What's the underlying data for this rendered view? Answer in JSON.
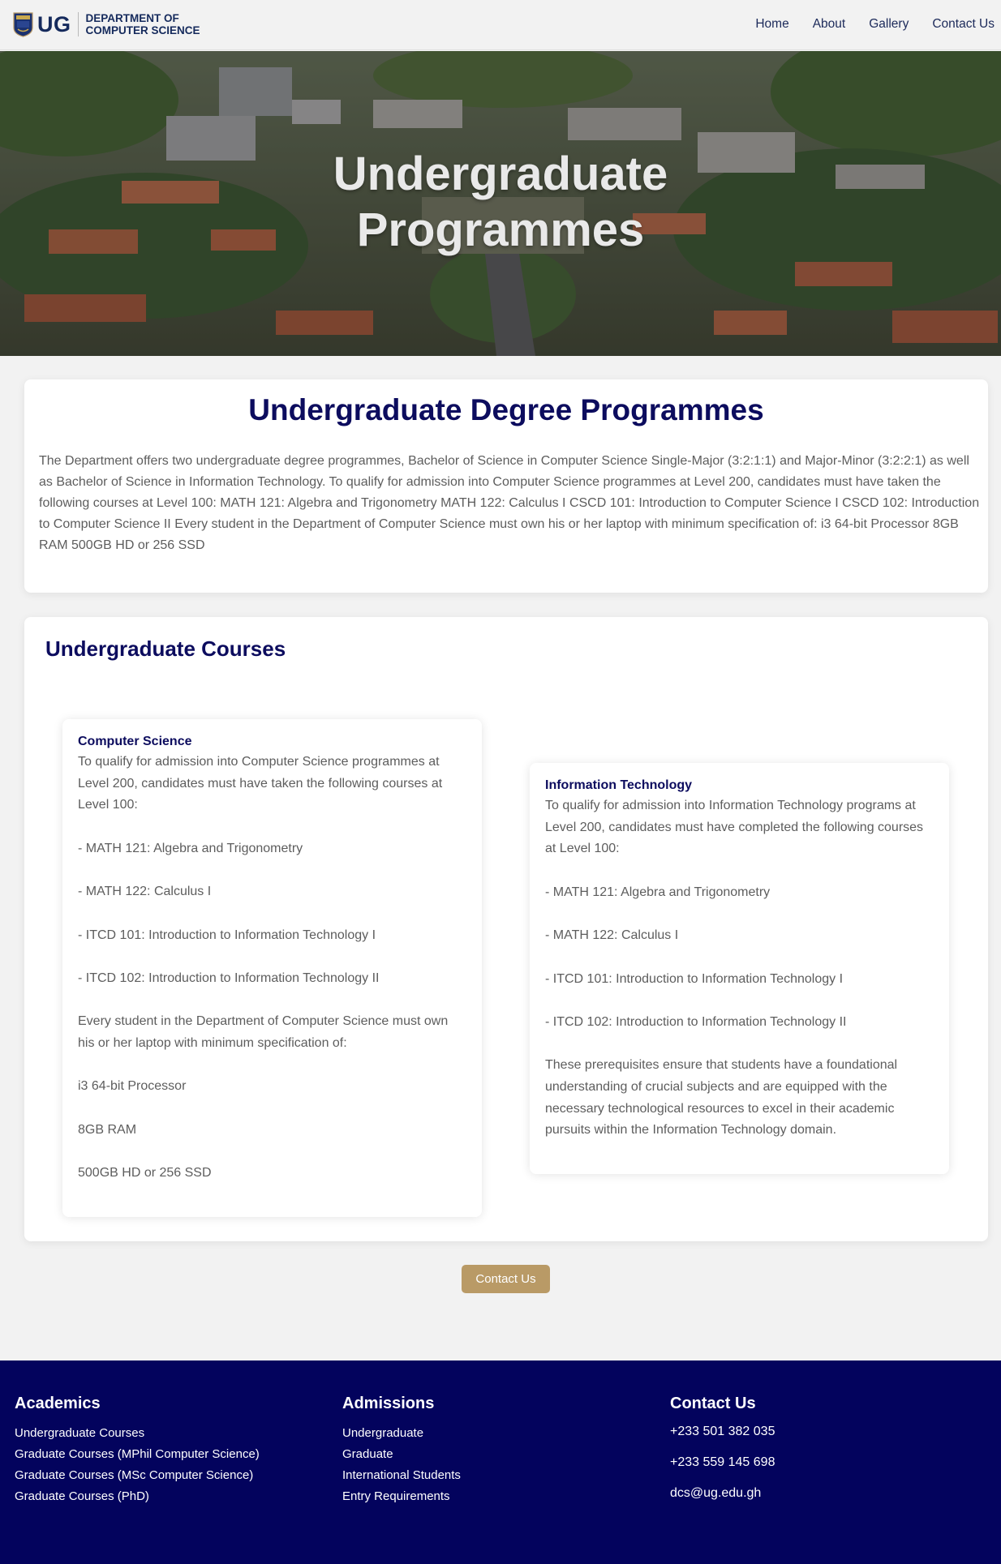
{
  "header": {
    "logo_text": "UG",
    "dept_line1": "DEPARTMENT OF",
    "dept_line2": "COMPUTER SCIENCE",
    "nav": [
      "Home",
      "About",
      "Gallery",
      "Contact Us"
    ]
  },
  "hero": {
    "title_line1": "Undergraduate",
    "title_line2": "Programmes"
  },
  "intro": {
    "title": "Undergraduate Degree Programmes",
    "body": "The Department offers two undergraduate degree programmes, Bachelor of Science in Computer Science Single-Major (3:2:1:1) and Major-Minor (3:2:2:1) as well as Bachelor of Science in Information Technology. To qualify for admission into Computer Science programmes at Level 200, candidates must have taken the following courses at Level 100: MATH 121: Algebra and Trigonometry MATH 122: Calculus I CSCD 101: Introduction to Computer Science I CSCD 102: Introduction to Computer Science II Every student in the Department of Computer Science must own his or her laptop with minimum specification of: i3 64-bit Processor 8GB RAM 500GB HD or 256 SSD"
  },
  "courses": {
    "title": "Undergraduate Courses",
    "computer_science": {
      "title": "Computer Science",
      "intro": "To qualify for admission into Computer Science programmes at Level 200, candidates must have taken the following courses at Level 100:",
      "courses": [
        "- MATH 121: Algebra and Trigonometry",
        "- MATH 122: Calculus I",
        "- ITCD 101: Introduction to Information Technology I",
        "- ITCD 102: Introduction to Information Technology II"
      ],
      "laptop_note": "Every student in the Department of Computer Science must own his or her laptop with minimum specification of:",
      "specs": [
        "i3 64-bit Processor",
        "8GB RAM",
        "500GB HD or 256 SSD"
      ]
    },
    "information_technology": {
      "title": "Information Technology",
      "intro": "To qualify for admission into Information Technology programs at Level 200, candidates must have completed the following courses at Level 100:",
      "courses": [
        "- MATH 121: Algebra and Trigonometry",
        "- MATH 122: Calculus I",
        "- ITCD 101: Introduction to Information Technology I",
        "- ITCD 102: Introduction to Information Technology II"
      ],
      "closing": "These prerequisites ensure that students have a foundational understanding of crucial subjects and are equipped with the necessary technological resources to excel in their academic pursuits within the Information Technology domain."
    }
  },
  "contact_button": "Contact Us",
  "footer": {
    "academics": {
      "title": "Academics",
      "links": [
        "Undergraduate Courses",
        "Graduate Courses (MPhil Computer Science)",
        "Graduate Courses (MSc Computer Science)",
        "Graduate Courses (PhD)"
      ]
    },
    "admissions": {
      "title": "Admissions",
      "links": [
        "Undergraduate",
        "Graduate",
        "International Students",
        "Entry Requirements"
      ]
    },
    "contact": {
      "title": "Contact Us",
      "phone1": "+233 501 382 035",
      "phone2": "+233 559 145 698",
      "email": "dcs@ug.edu.gh"
    }
  },
  "colors": {
    "navy": "#0c0c5e",
    "footer_bg": "#03035d",
    "button_gold": "#b99a66"
  }
}
